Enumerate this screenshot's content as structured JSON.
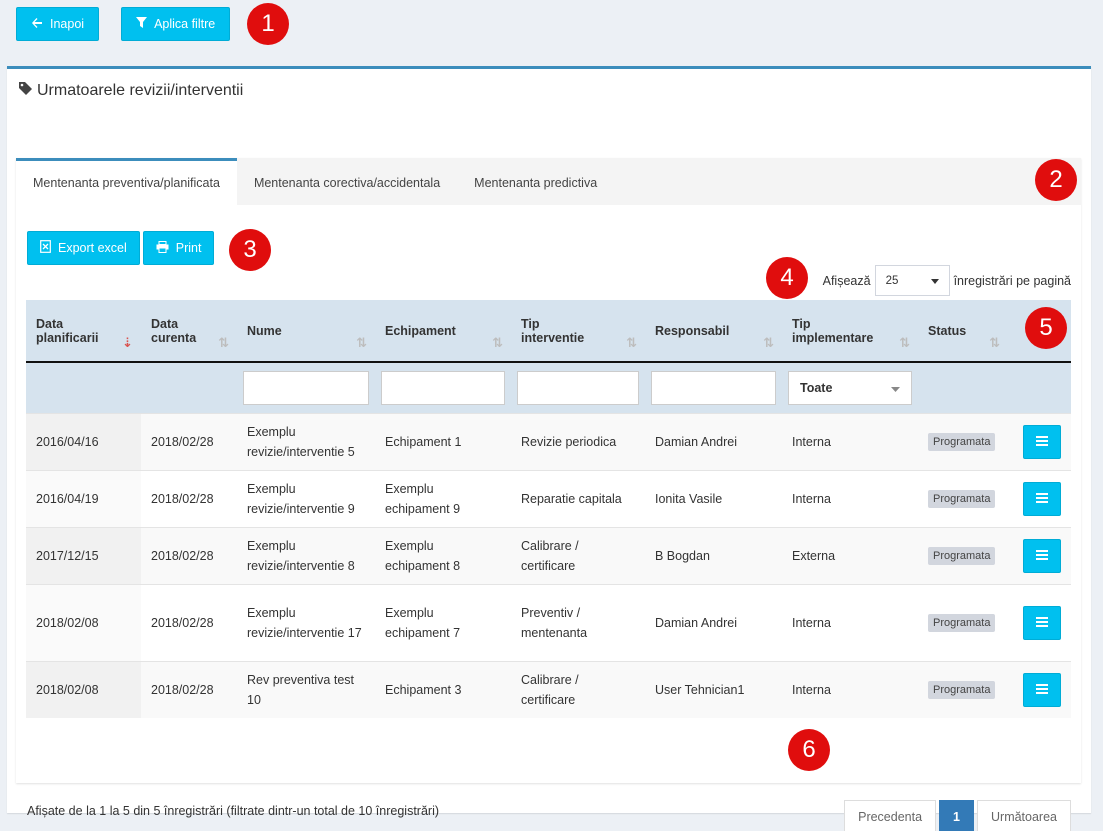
{
  "top": {
    "back_label": "Inapoi",
    "filter_label": "Aplica filtre"
  },
  "markers": [
    "1",
    "2",
    "3",
    "4",
    "5",
    "6"
  ],
  "box": {
    "title": "Urmatoarele revizii/interventii"
  },
  "tabs": [
    {
      "label": "Mentenanta preventiva/planificata",
      "active": true
    },
    {
      "label": "Mentenanta corectiva/accidentala"
    },
    {
      "label": "Mentenanta predictiva"
    }
  ],
  "toolbar": {
    "export_label": "Export excel",
    "print_label": "Print"
  },
  "length": {
    "prefix": "Afișează",
    "value": "25",
    "suffix": "înregistrări pe pagină"
  },
  "table": {
    "columns": [
      {
        "line1": "Data",
        "line2": "planificarii"
      },
      {
        "line1": "Data",
        "line2": "curenta"
      },
      {
        "line1": "Nume",
        "line2": ""
      },
      {
        "line1": "Echipament",
        "line2": ""
      },
      {
        "line1": "Tip",
        "line2": "interventie"
      },
      {
        "line1": "Responsabil",
        "line2": ""
      },
      {
        "line1": "Tip",
        "line2": "implementare"
      },
      {
        "line1": "Status",
        "line2": ""
      }
    ],
    "filter_select": "Toate",
    "rows": [
      {
        "data_planificarii": "2016/04/16",
        "data_curenta": "2018/02/28",
        "nume": "Exemplu revizie/interventie 5",
        "echipament": "Echipament 1",
        "tip_interventie": "Revizie periodica",
        "responsabil": "Damian Andrei",
        "tip_implementare": "Interna",
        "status": "Programata"
      },
      {
        "data_planificarii": "2016/04/19",
        "data_curenta": "2018/02/28",
        "nume": "Exemplu revizie/interventie 9",
        "echipament": "Exemplu echipament 9",
        "tip_interventie": "Reparatie capitala",
        "responsabil": "Ionita Vasile",
        "tip_implementare": "Interna",
        "status": "Programata"
      },
      {
        "data_planificarii": "2017/12/15",
        "data_curenta": "2018/02/28",
        "nume": "Exemplu revizie/interventie 8",
        "echipament": "Exemplu echipament 8",
        "tip_interventie": "Calibrare / certificare",
        "responsabil": "B Bogdan",
        "tip_implementare": "Externa",
        "status": "Programata"
      },
      {
        "data_planificarii": "2018/02/08",
        "data_curenta": "2018/02/28",
        "nume": "Exemplu revizie/interventie 17",
        "echipament": "Exemplu echipament 7",
        "tip_interventie": "Preventiv / mentenanta",
        "responsabil": "Damian Andrei",
        "tip_implementare": "Interna",
        "status": "Programata"
      },
      {
        "data_planificarii": "2018/02/08",
        "data_curenta": "2018/02/28",
        "nume": "Rev preventiva test 10",
        "echipament": "Echipament 3",
        "tip_interventie": "Calibrare / certificare",
        "responsabil": "User Tehnician1",
        "tip_implementare": "Interna",
        "status": "Programata"
      }
    ]
  },
  "footer": {
    "info": "Afișate de la 1 la 5 din 5 înregistrări (filtrate dintr-un total de 10 înregistrări)",
    "prev_label": "Precedenta",
    "page": "1",
    "next_label": "Următoarea"
  },
  "colors": {
    "accent": "#3c8dbc",
    "button": "#00c0ef",
    "marker": "#e00d0d",
    "header": "#d6e3ee"
  }
}
